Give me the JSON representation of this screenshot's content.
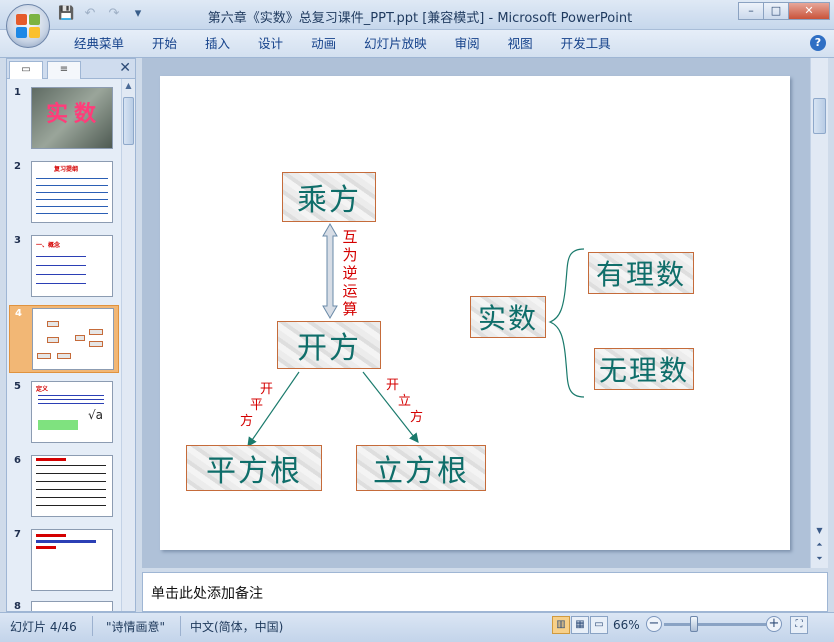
{
  "window": {
    "title": "第六章《实数》总复习课件_PPT.ppt [兼容模式] - Microsoft PowerPoint",
    "controls": {
      "minimize": "–",
      "maximize": "□",
      "close": "✕"
    }
  },
  "quick_access": {
    "save_icon": "💾",
    "undo_icon": "↶",
    "redo_icon": "↷",
    "customize_icon": "▾"
  },
  "ribbon": {
    "tabs": [
      "经典菜单",
      "开始",
      "插入",
      "设计",
      "动画",
      "幻灯片放映",
      "审阅",
      "视图",
      "开发工具"
    ],
    "help": "?"
  },
  "left_pane": {
    "tab_slides_icon": "▭",
    "tab_outline_icon": "≡",
    "close": "✕",
    "slides": [
      {
        "num": "1",
        "title": "实数"
      },
      {
        "num": "2",
        "title": "复习提纲"
      },
      {
        "num": "3",
        "title": "一、概念"
      },
      {
        "num": "4",
        "title": ""
      },
      {
        "num": "5",
        "title": "定义"
      },
      {
        "num": "6",
        "title": ""
      },
      {
        "num": "7",
        "title": ""
      },
      {
        "num": "8",
        "title": ""
      }
    ],
    "selected_index": 3
  },
  "slide": {
    "nodes": {
      "chengfang": "乘方",
      "kaifang": "开方",
      "pingfanggen": "平方根",
      "lifanggen": "立方根",
      "shishu": "实数",
      "youlishu": "有理数",
      "wulishu": "无理数"
    },
    "relation_label": [
      "互",
      "为",
      "逆",
      "运",
      "算"
    ],
    "edge_left_label": [
      "开",
      "平",
      "方"
    ],
    "edge_right_label": [
      "开",
      "立",
      "方"
    ],
    "colors": {
      "node_text": "#0f6e6a",
      "label_red": "#d40000",
      "line": "#1a7a6c",
      "border": "#c56b3a"
    }
  },
  "notes": {
    "placeholder": "单击此处添加备注"
  },
  "status": {
    "slide_counter": "幻灯片 4/46",
    "theme": "\"诗情画意\"",
    "language": "中文(简体，中国)",
    "zoom": "66%",
    "zoom_level": 0.66,
    "zoom_out": "−",
    "zoom_in": "+"
  }
}
